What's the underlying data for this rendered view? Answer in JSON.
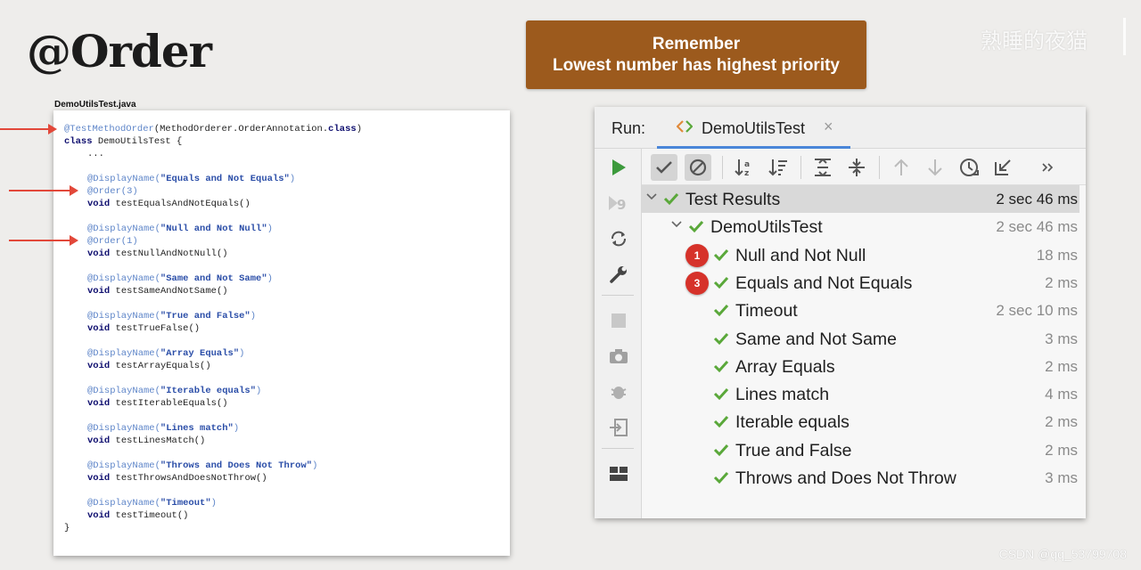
{
  "slide": {
    "title": "@Order",
    "callout_line1": "Remember",
    "callout_line2": "Lowest number has highest priority",
    "watermark": "熟睡的夜猫",
    "footer": "CSDN @qq_53799708"
  },
  "code": {
    "filename": "DemoUtilsTest.java",
    "class_annotation": "@TestMethodOrder",
    "class_annotation_args": "(MethodOrderer.OrderAnnotation.",
    "class_kw": "class",
    "class_annotation_close": ")",
    "class_decl_kw": "class",
    "class_decl_rest": " DemoUtilsTest {",
    "ellipsis": "...",
    "display_annotation": "@DisplayName(",
    "void_kw": "void",
    "methods": [
      {
        "display": "\"Equals and Not Equals\"",
        "order": "@Order(3)",
        "name": "testEqualsAndNotEquals()"
      },
      {
        "display": "\"Null and Not Null\"",
        "order": "@Order(1)",
        "name": "testNullAndNotNull()"
      },
      {
        "display": "\"Same and Not Same\"",
        "order": "",
        "name": "testSameAndNotSame()"
      },
      {
        "display": "\"True and False\"",
        "order": "",
        "name": "testTrueFalse()"
      },
      {
        "display": "\"Array Equals\"",
        "order": "",
        "name": "testArrayEquals()"
      },
      {
        "display": "\"Iterable equals\"",
        "order": "",
        "name": "testIterableEquals()"
      },
      {
        "display": "\"Lines match\"",
        "order": "",
        "name": "testLinesMatch()"
      },
      {
        "display": "\"Throws and Does Not Throw\"",
        "order": "",
        "name": "testThrowsAndDoesNotThrow()"
      },
      {
        "display": "\"Timeout\"",
        "order": "",
        "name": "testTimeout()"
      }
    ],
    "closing_brace": "}",
    "close_paren": ")"
  },
  "run": {
    "label": "Run:",
    "tab_label": "DemoUtilsTest",
    "tab_close": "×",
    "colors": {
      "check": "#5aa83a",
      "badge": "#d6322a",
      "run": "#3c9a3c"
    },
    "tree": [
      {
        "label": "Test Results",
        "time": "2 sec 46 ms",
        "level": 0,
        "badge": "",
        "chevron": true
      },
      {
        "label": "DemoUtilsTest",
        "time": "2 sec 46 ms",
        "level": 1,
        "badge": "",
        "chevron": true
      },
      {
        "label": "Null and Not Null",
        "time": "18 ms",
        "level": 2,
        "badge": "1",
        "chevron": false
      },
      {
        "label": "Equals and Not Equals",
        "time": "2 ms",
        "level": 2,
        "badge": "3",
        "chevron": false
      },
      {
        "label": "Timeout",
        "time": "2 sec 10 ms",
        "level": 2,
        "badge": "",
        "chevron": false
      },
      {
        "label": "Same and Not Same",
        "time": "3 ms",
        "level": 2,
        "badge": "",
        "chevron": false
      },
      {
        "label": "Array Equals",
        "time": "2 ms",
        "level": 2,
        "badge": "",
        "chevron": false
      },
      {
        "label": "Lines match",
        "time": "4 ms",
        "level": 2,
        "badge": "",
        "chevron": false
      },
      {
        "label": "Iterable equals",
        "time": "2 ms",
        "level": 2,
        "badge": "",
        "chevron": false
      },
      {
        "label": "True and False",
        "time": "2 ms",
        "level": 2,
        "badge": "",
        "chevron": false
      },
      {
        "label": "Throws and Does Not Throw",
        "time": "3 ms",
        "level": 2,
        "badge": "",
        "chevron": false
      }
    ]
  }
}
